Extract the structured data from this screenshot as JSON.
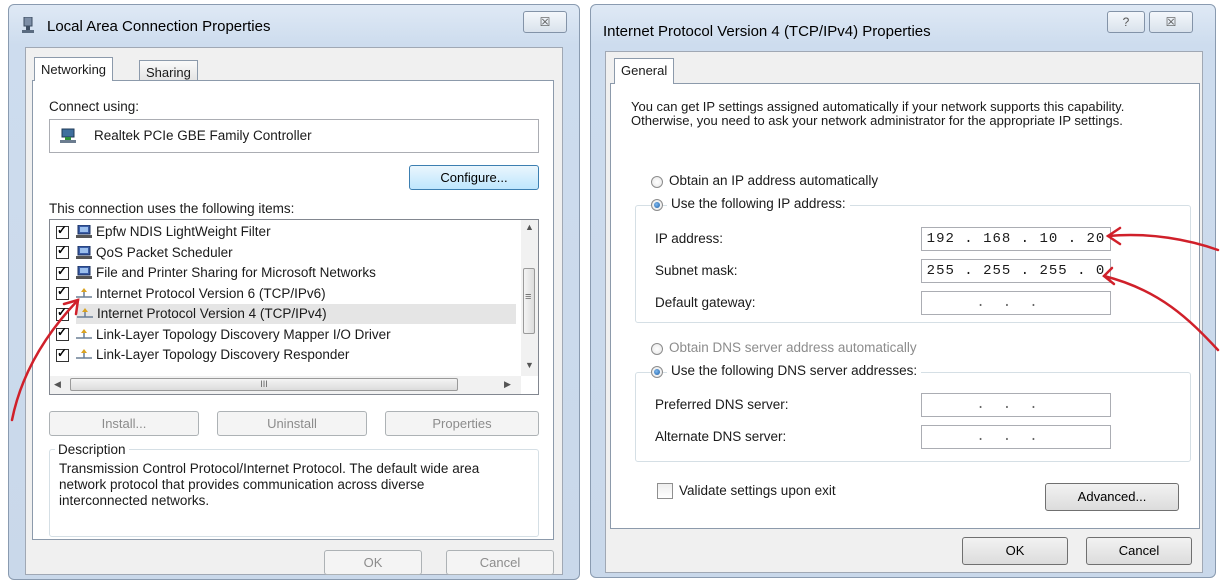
{
  "lan_dialog": {
    "title": "Local Area Connection Properties",
    "close_glyph": "☒",
    "tabs": [
      "Networking",
      "Sharing"
    ],
    "connect_using_label": "Connect using:",
    "adapter_name": "Realtek PCIe GBE Family Controller",
    "configure_button": "Configure...",
    "items_label": "This connection uses the following items:",
    "items": [
      {
        "label": "Epfw NDIS LightWeight Filter",
        "checked": true,
        "icon": "network-client-icon"
      },
      {
        "label": "QoS Packet Scheduler",
        "checked": true,
        "icon": "network-client-icon"
      },
      {
        "label": "File and Printer Sharing for Microsoft Networks",
        "checked": true,
        "icon": "network-client-icon"
      },
      {
        "label": "Internet Protocol Version 6 (TCP/IPv6)",
        "checked": true,
        "icon": "protocol-icon"
      },
      {
        "label": "Internet Protocol Version 4 (TCP/IPv4)",
        "checked": true,
        "selected": true,
        "icon": "protocol-icon"
      },
      {
        "label": "Link-Layer Topology Discovery Mapper I/O Driver",
        "checked": true,
        "icon": "protocol-icon"
      },
      {
        "label": "Link-Layer Topology Discovery Responder",
        "checked": true,
        "icon": "protocol-icon"
      }
    ],
    "hscroll_thumb_glyph": "III",
    "vscroll_thumb_glyph": "≡",
    "install_button": "Install...",
    "uninstall_button": "Uninstall",
    "properties_button": "Properties",
    "description_title": "Description",
    "description_text": "Transmission Control Protocol/Internet Protocol. The default wide area network protocol that provides communication across diverse interconnected networks.",
    "ok_button": "OK",
    "cancel_button": "Cancel"
  },
  "ipv4_dialog": {
    "title": "Internet Protocol Version 4 (TCP/IPv4) Properties",
    "help_glyph": "?",
    "close_glyph": "☒",
    "tabs": [
      "General"
    ],
    "intro_text": "You can get IP settings assigned automatically if your network supports this capability. Otherwise, you need to ask your network administrator for the appropriate IP settings.",
    "obtain_ip_auto": "Obtain an IP address automatically",
    "use_following_ip": "Use the following IP address:",
    "ip_address_label": "IP address:",
    "ip_address_value": "192 . 168 .  10  . 20",
    "subnet_mask_label": "Subnet mask:",
    "subnet_mask_value": "255 . 255 . 255 .  0",
    "default_gateway_label": "Default gateway:",
    "empty_ip_value": "...",
    "obtain_dns_auto": "Obtain DNS server address automatically",
    "use_following_dns": "Use the following DNS server addresses:",
    "preferred_dns_label": "Preferred DNS server:",
    "alternate_dns_label": "Alternate DNS server:",
    "validate_label": "Validate settings upon exit",
    "advanced_button": "Advanced...",
    "ok_button": "OK",
    "cancel_button": "Cancel"
  },
  "colors": {
    "annotation_red": "#d0202a",
    "selection_gray": "#e5e5e5",
    "focus_blue": "#3c7fb1"
  }
}
